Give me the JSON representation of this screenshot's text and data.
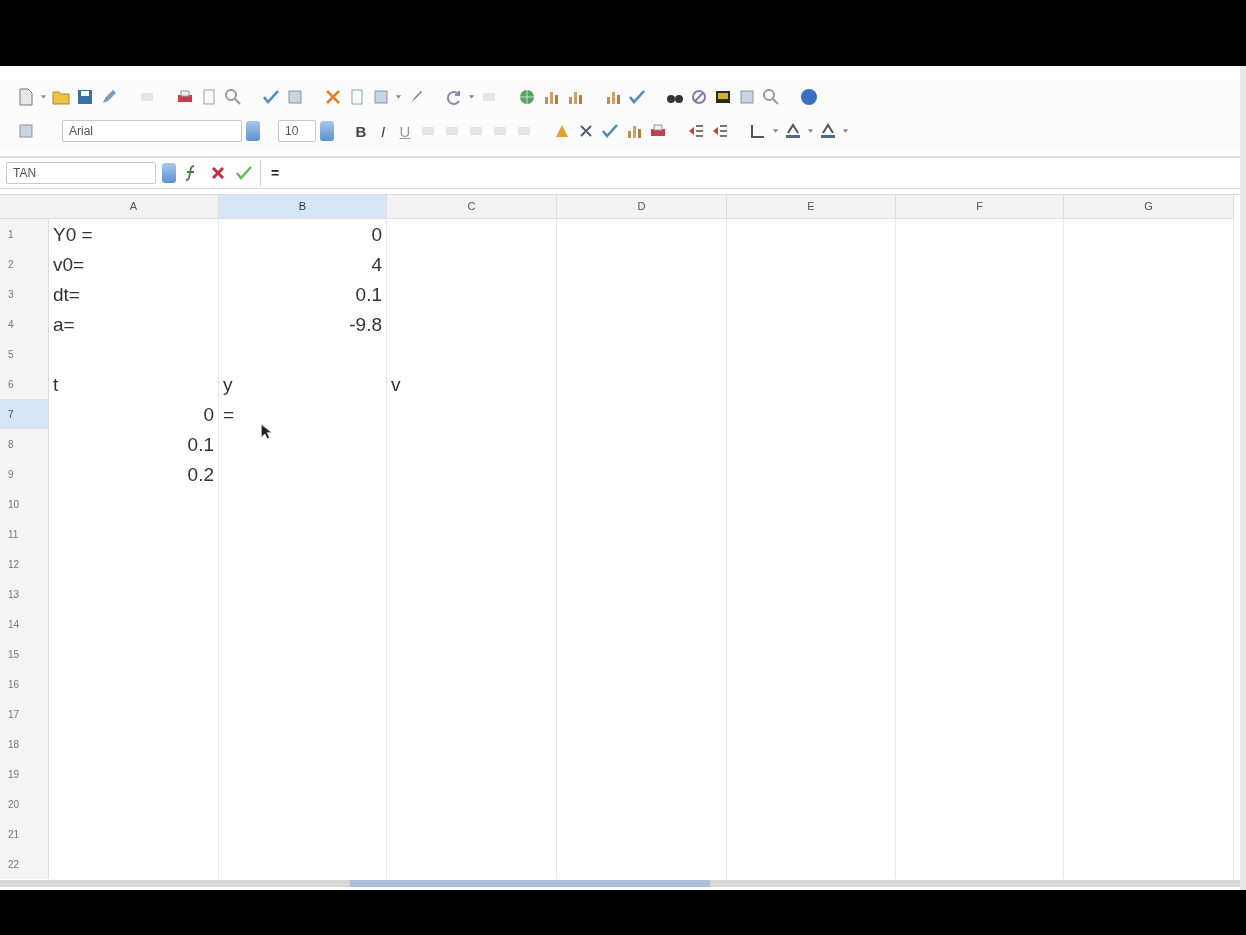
{
  "toolbar": {
    "font_name": "Arial",
    "font_size": "10",
    "format_buttons": [
      "B",
      "I",
      "U"
    ]
  },
  "formula_bar": {
    "name_box": "TAN",
    "content": "="
  },
  "columns": [
    {
      "label": "A",
      "selected": false
    },
    {
      "label": "B",
      "selected": true
    },
    {
      "label": "C",
      "selected": false
    },
    {
      "label": "D",
      "selected": false
    },
    {
      "label": "E",
      "selected": false
    },
    {
      "label": "F",
      "selected": false
    },
    {
      "label": "G",
      "selected": false
    }
  ],
  "rows": [
    {
      "number": "1",
      "selected": false,
      "cells": [
        {
          "text": "Y0 =",
          "kind": "text"
        },
        {
          "text": "0",
          "kind": "number"
        }
      ]
    },
    {
      "number": "2",
      "selected": false,
      "cells": [
        {
          "text": "v0=",
          "kind": "text"
        },
        {
          "text": "4",
          "kind": "number"
        }
      ]
    },
    {
      "number": "3",
      "selected": false,
      "cells": [
        {
          "text": "dt=",
          "kind": "text"
        },
        {
          "text": "0.1",
          "kind": "number"
        }
      ]
    },
    {
      "number": "4",
      "selected": false,
      "cells": [
        {
          "text": "a=",
          "kind": "text"
        },
        {
          "text": "-9.8",
          "kind": "number"
        }
      ]
    },
    {
      "number": "5",
      "selected": false
    },
    {
      "number": "6",
      "selected": false,
      "cells": [
        {
          "text": "t",
          "kind": "text"
        },
        {
          "text": "y",
          "kind": "text"
        },
        {
          "text": "v",
          "kind": "text"
        }
      ]
    },
    {
      "number": "7",
      "selected": true,
      "cells": [
        {
          "text": "0",
          "kind": "number"
        },
        {
          "text": "=",
          "kind": "text"
        }
      ]
    },
    {
      "number": "8",
      "selected": false,
      "cells": [
        {
          "text": "0.1",
          "kind": "number"
        }
      ]
    },
    {
      "number": "9",
      "selected": false,
      "cells": [
        {
          "text": "0.2",
          "kind": "number"
        }
      ]
    },
    {
      "number": "10",
      "selected": false
    },
    {
      "number": "11",
      "selected": false
    },
    {
      "number": "12",
      "selected": false
    },
    {
      "number": "13",
      "selected": false
    },
    {
      "number": "14",
      "selected": false
    },
    {
      "number": "15",
      "selected": false
    },
    {
      "number": "16",
      "selected": false
    },
    {
      "number": "17",
      "selected": false
    },
    {
      "number": "18",
      "selected": false
    },
    {
      "number": "19",
      "selected": false
    },
    {
      "number": "20",
      "selected": false
    },
    {
      "number": "21",
      "selected": false
    },
    {
      "number": "22",
      "selected": false
    }
  ]
}
